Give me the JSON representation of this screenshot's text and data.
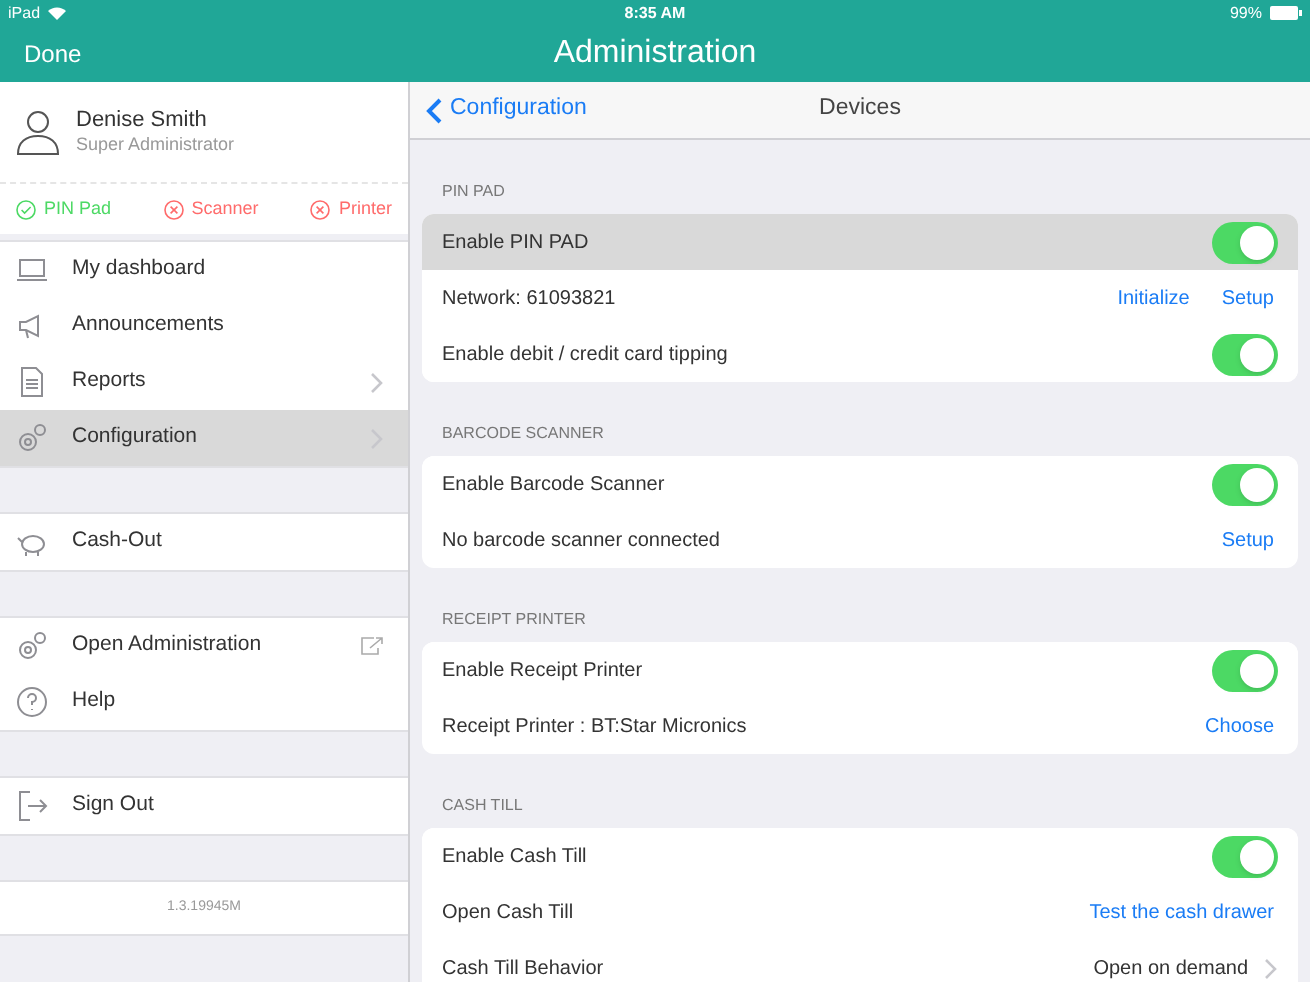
{
  "status_bar": {
    "device": "iPad",
    "time": "8:35 AM",
    "battery": "99%"
  },
  "nav_bar": {
    "left_button": "Done",
    "title": "Administration"
  },
  "sidebar": {
    "user": {
      "name": "Denise Smith",
      "role": "Super Administrator"
    },
    "devices": [
      {
        "label": "PIN Pad",
        "ok": true
      },
      {
        "label": "Scanner",
        "ok": false
      },
      {
        "label": "Printer",
        "ok": false
      }
    ],
    "groups": [
      [
        {
          "label": "My dashboard",
          "selected": false,
          "kind": "plain"
        },
        {
          "label": "Announcements",
          "selected": false,
          "kind": "plain"
        },
        {
          "label": "Reports",
          "selected": false,
          "kind": "submenu"
        },
        {
          "label": "Configuration",
          "selected": true,
          "kind": "submenu"
        }
      ],
      [
        {
          "label": "Cash-Out",
          "selected": false,
          "kind": "plain"
        }
      ],
      [
        {
          "label": "Open Administration",
          "selected": false,
          "kind": "external"
        },
        {
          "label": "Help",
          "selected": false,
          "kind": "plain"
        }
      ],
      [
        {
          "label": "Sign Out",
          "selected": false,
          "kind": "plain"
        }
      ]
    ],
    "version": "1.3.19945M"
  },
  "detail": {
    "back": "Configuration",
    "title": "Devices",
    "sections": [
      {
        "header": "PIN PAD",
        "rows": [
          {
            "kind": "toggle",
            "label": "Enable PIN PAD",
            "on": true,
            "selected": true
          },
          {
            "kind": "actions",
            "label": "Network: 61093821",
            "actions": [
              "Initialize",
              "Setup"
            ]
          },
          {
            "kind": "toggle",
            "label": "Enable debit / credit card tipping",
            "on": true,
            "selected": false
          }
        ]
      },
      {
        "header": "BARCODE SCANNER",
        "rows": [
          {
            "kind": "toggle",
            "label": "Enable Barcode Scanner",
            "on": true,
            "selected": false
          },
          {
            "kind": "actions",
            "label": "No barcode scanner connected",
            "actions": [
              "Setup"
            ]
          }
        ]
      },
      {
        "header": "RECEIPT PRINTER",
        "rows": [
          {
            "kind": "toggle",
            "label": "Enable Receipt Printer",
            "on": true,
            "selected": false
          },
          {
            "kind": "actions",
            "label": "Receipt Printer : BT:Star Micronics",
            "actions": [
              "Choose"
            ]
          }
        ]
      },
      {
        "header": "CASH TILL",
        "rows": [
          {
            "kind": "toggle",
            "label": "Enable Cash Till",
            "on": true,
            "selected": false
          },
          {
            "kind": "actions",
            "label": "Open Cash Till",
            "actions": [
              "Test the cash drawer"
            ]
          },
          {
            "kind": "value",
            "label": "Cash Till Behavior",
            "value": "Open on demand"
          }
        ]
      }
    ]
  }
}
